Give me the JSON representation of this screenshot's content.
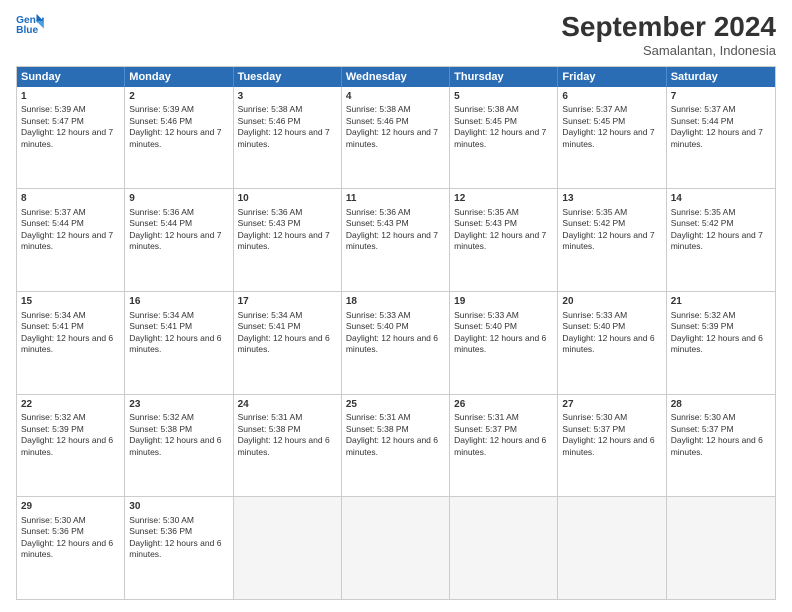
{
  "logo": {
    "line1": "General",
    "line2": "Blue"
  },
  "title": "September 2024",
  "subtitle": "Samalantan, Indonesia",
  "days": [
    "Sunday",
    "Monday",
    "Tuesday",
    "Wednesday",
    "Thursday",
    "Friday",
    "Saturday"
  ],
  "weeks": [
    [
      {
        "day": 1,
        "sunrise": "5:39 AM",
        "sunset": "5:47 PM",
        "daylight": "12 hours and 7 minutes."
      },
      {
        "day": 2,
        "sunrise": "5:39 AM",
        "sunset": "5:46 PM",
        "daylight": "12 hours and 7 minutes."
      },
      {
        "day": 3,
        "sunrise": "5:38 AM",
        "sunset": "5:46 PM",
        "daylight": "12 hours and 7 minutes."
      },
      {
        "day": 4,
        "sunrise": "5:38 AM",
        "sunset": "5:46 PM",
        "daylight": "12 hours and 7 minutes."
      },
      {
        "day": 5,
        "sunrise": "5:38 AM",
        "sunset": "5:45 PM",
        "daylight": "12 hours and 7 minutes."
      },
      {
        "day": 6,
        "sunrise": "5:37 AM",
        "sunset": "5:45 PM",
        "daylight": "12 hours and 7 minutes."
      },
      {
        "day": 7,
        "sunrise": "5:37 AM",
        "sunset": "5:44 PM",
        "daylight": "12 hours and 7 minutes."
      }
    ],
    [
      {
        "day": 8,
        "sunrise": "5:37 AM",
        "sunset": "5:44 PM",
        "daylight": "12 hours and 7 minutes."
      },
      {
        "day": 9,
        "sunrise": "5:36 AM",
        "sunset": "5:44 PM",
        "daylight": "12 hours and 7 minutes."
      },
      {
        "day": 10,
        "sunrise": "5:36 AM",
        "sunset": "5:43 PM",
        "daylight": "12 hours and 7 minutes."
      },
      {
        "day": 11,
        "sunrise": "5:36 AM",
        "sunset": "5:43 PM",
        "daylight": "12 hours and 7 minutes."
      },
      {
        "day": 12,
        "sunrise": "5:35 AM",
        "sunset": "5:43 PM",
        "daylight": "12 hours and 7 minutes."
      },
      {
        "day": 13,
        "sunrise": "5:35 AM",
        "sunset": "5:42 PM",
        "daylight": "12 hours and 7 minutes."
      },
      {
        "day": 14,
        "sunrise": "5:35 AM",
        "sunset": "5:42 PM",
        "daylight": "12 hours and 7 minutes."
      }
    ],
    [
      {
        "day": 15,
        "sunrise": "5:34 AM",
        "sunset": "5:41 PM",
        "daylight": "12 hours and 6 minutes."
      },
      {
        "day": 16,
        "sunrise": "5:34 AM",
        "sunset": "5:41 PM",
        "daylight": "12 hours and 6 minutes."
      },
      {
        "day": 17,
        "sunrise": "5:34 AM",
        "sunset": "5:41 PM",
        "daylight": "12 hours and 6 minutes."
      },
      {
        "day": 18,
        "sunrise": "5:33 AM",
        "sunset": "5:40 PM",
        "daylight": "12 hours and 6 minutes."
      },
      {
        "day": 19,
        "sunrise": "5:33 AM",
        "sunset": "5:40 PM",
        "daylight": "12 hours and 6 minutes."
      },
      {
        "day": 20,
        "sunrise": "5:33 AM",
        "sunset": "5:40 PM",
        "daylight": "12 hours and 6 minutes."
      },
      {
        "day": 21,
        "sunrise": "5:32 AM",
        "sunset": "5:39 PM",
        "daylight": "12 hours and 6 minutes."
      }
    ],
    [
      {
        "day": 22,
        "sunrise": "5:32 AM",
        "sunset": "5:39 PM",
        "daylight": "12 hours and 6 minutes."
      },
      {
        "day": 23,
        "sunrise": "5:32 AM",
        "sunset": "5:38 PM",
        "daylight": "12 hours and 6 minutes."
      },
      {
        "day": 24,
        "sunrise": "5:31 AM",
        "sunset": "5:38 PM",
        "daylight": "12 hours and 6 minutes."
      },
      {
        "day": 25,
        "sunrise": "5:31 AM",
        "sunset": "5:38 PM",
        "daylight": "12 hours and 6 minutes."
      },
      {
        "day": 26,
        "sunrise": "5:31 AM",
        "sunset": "5:37 PM",
        "daylight": "12 hours and 6 minutes."
      },
      {
        "day": 27,
        "sunrise": "5:30 AM",
        "sunset": "5:37 PM",
        "daylight": "12 hours and 6 minutes."
      },
      {
        "day": 28,
        "sunrise": "5:30 AM",
        "sunset": "5:37 PM",
        "daylight": "12 hours and 6 minutes."
      }
    ],
    [
      {
        "day": 29,
        "sunrise": "5:30 AM",
        "sunset": "5:36 PM",
        "daylight": "12 hours and 6 minutes."
      },
      {
        "day": 30,
        "sunrise": "5:30 AM",
        "sunset": "5:36 PM",
        "daylight": "12 hours and 6 minutes."
      },
      null,
      null,
      null,
      null,
      null
    ]
  ]
}
